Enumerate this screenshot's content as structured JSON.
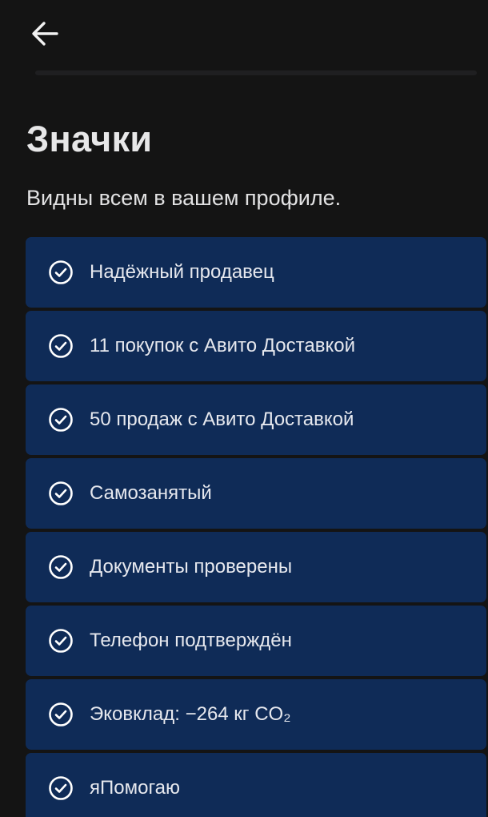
{
  "header": {
    "back_icon": "arrow-left-icon"
  },
  "title": "Значки",
  "subtitle": "Видны всем в вашем профиле.",
  "colors": {
    "background": "#141414",
    "card": "#0f2b57",
    "text": "#e7e7e8"
  },
  "badges": [
    {
      "label": "Надёжный продавец",
      "icon": "check-circle-icon"
    },
    {
      "label": "11 покупок с Авито Доставкой",
      "icon": "check-circle-icon"
    },
    {
      "label": "50 продаж с Авито Доставкой",
      "icon": "check-circle-icon"
    },
    {
      "label": "Самозанятый",
      "icon": "check-circle-icon"
    },
    {
      "label": "Документы проверены",
      "icon": "check-circle-icon"
    },
    {
      "label": "Телефон подтверждён",
      "icon": "check-circle-icon"
    },
    {
      "label": "Эковклад: −264 кг CO₂",
      "icon": "check-circle-icon"
    },
    {
      "label": "яПомогаю",
      "icon": "check-circle-icon"
    }
  ]
}
